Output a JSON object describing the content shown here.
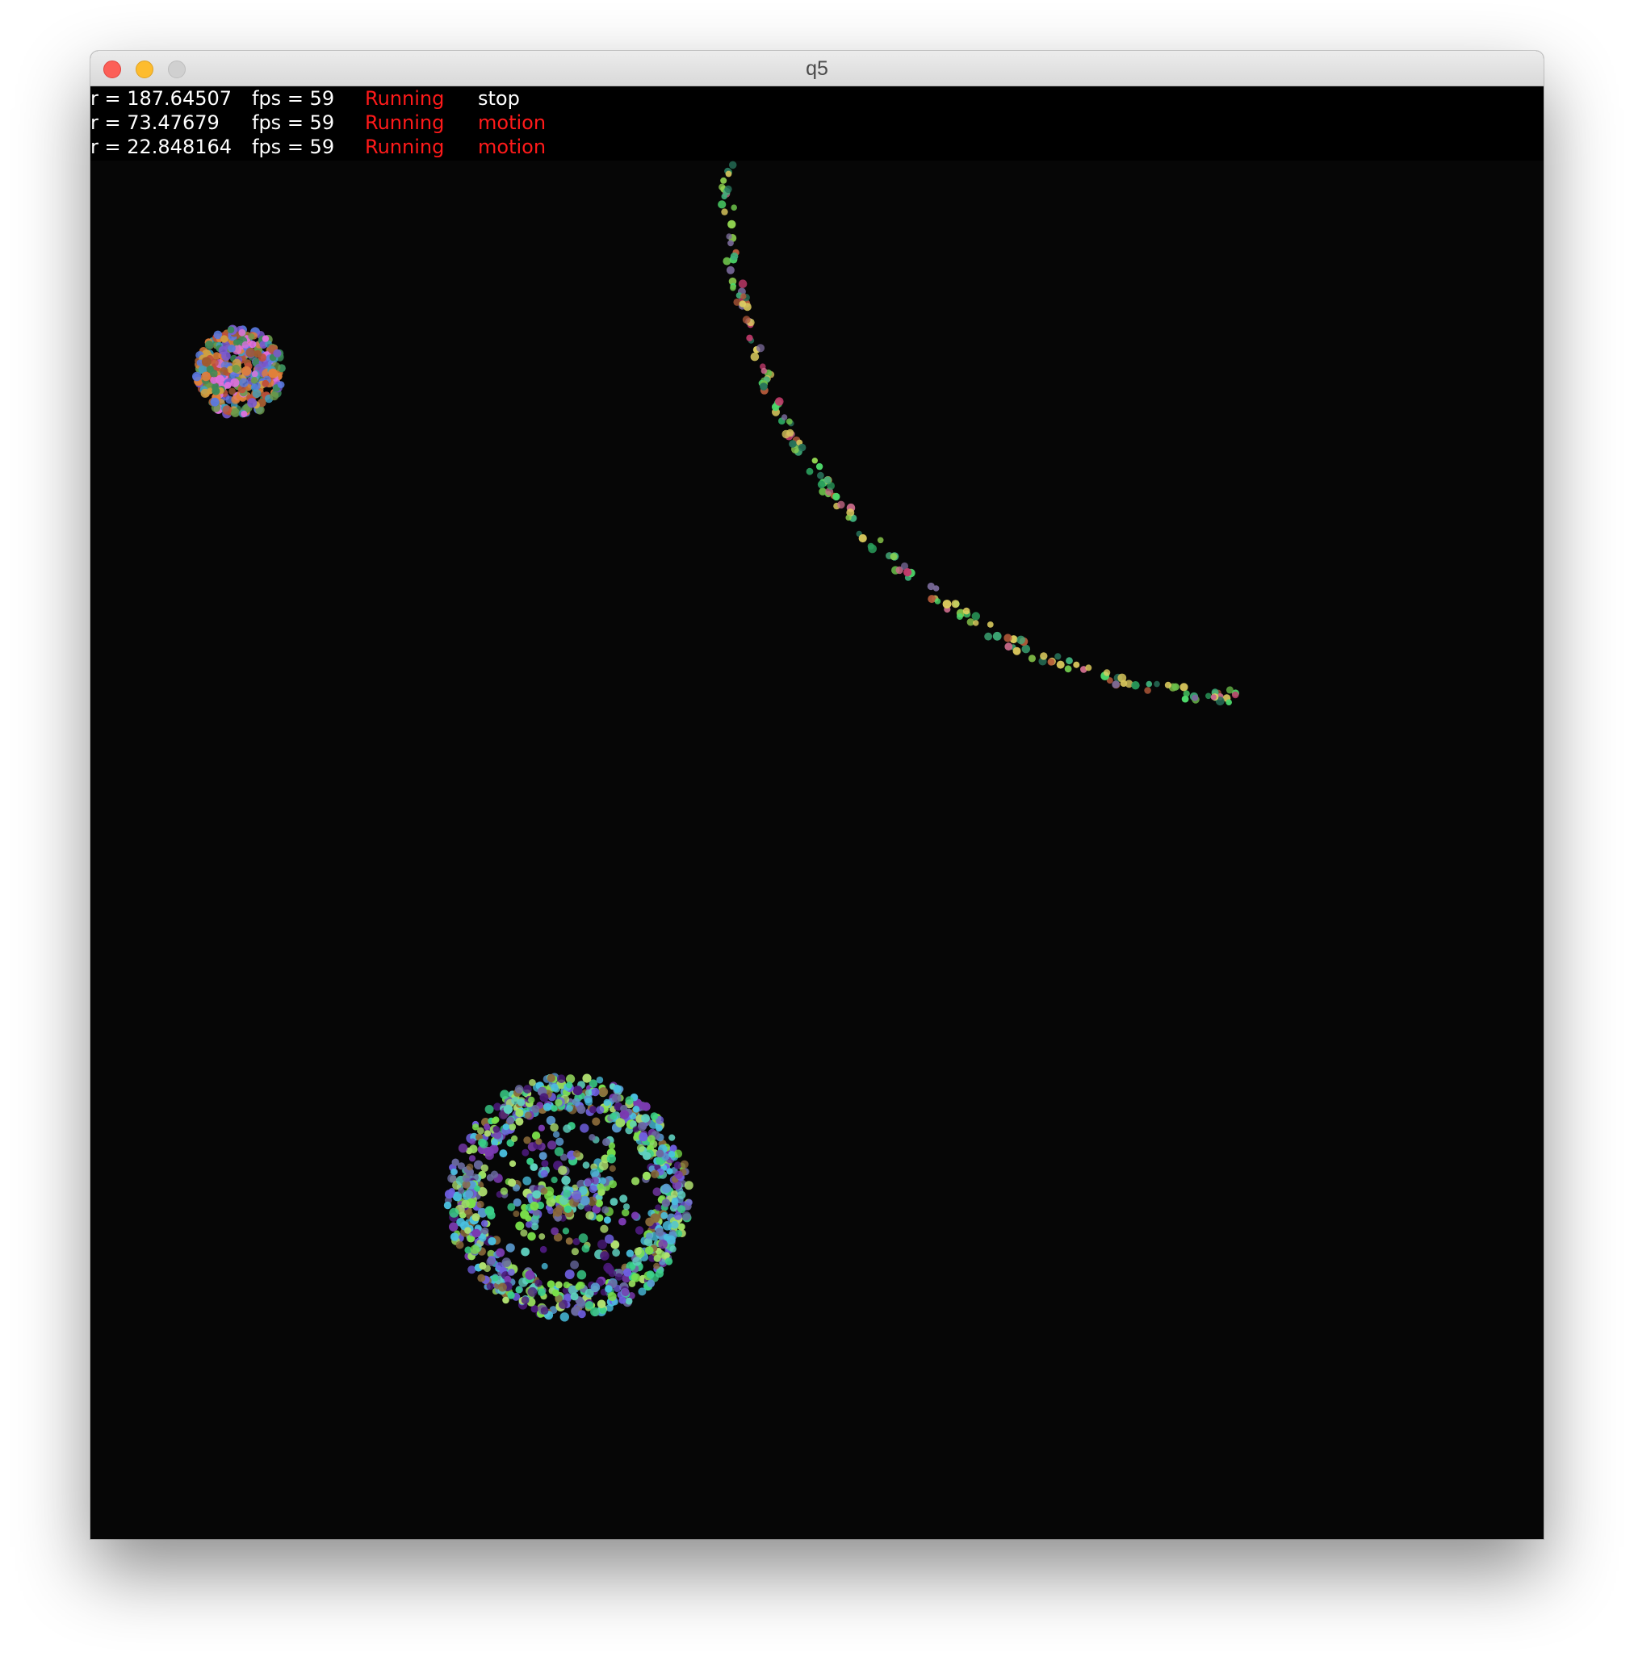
{
  "window": {
    "title": "q5"
  },
  "hud": {
    "rows": [
      {
        "r": "r = 187.64507",
        "fps": "fps = 59",
        "status": "Running",
        "mode": "stop",
        "status_color": "#ff1a1a",
        "mode_color": "#ffffff"
      },
      {
        "r": "r = 73.47679",
        "fps": "fps = 59",
        "status": "Running",
        "mode": "motion",
        "status_color": "#ff1a1a",
        "mode_color": "#ff1a1a"
      },
      {
        "r": "r = 22.848164",
        "fps": "fps = 59",
        "status": "Running",
        "mode": "motion",
        "status_color": "#ff1a1a",
        "mode_color": "#ff1a1a"
      }
    ]
  },
  "colors": {
    "canvas_background": "#060606",
    "hud_background": "#000000",
    "text_default": "#ffffff",
    "text_running": "#ff1a1a"
  },
  "particle_clusters": [
    {
      "name": "large-ring-cluster",
      "radius_value": 187.64507,
      "palette": [
        "#2a9d5c",
        "#c23a6b",
        "#8fd14f",
        "#3fae7a",
        "#d4c25a",
        "#6bbf4a",
        "#c96a8a",
        "#4dd86a",
        "#b45a3a",
        "#27725a",
        "#e0d060",
        "#7a6a9a"
      ]
    },
    {
      "name": "medium-disc-cluster",
      "radius_value": 73.47679,
      "palette": [
        "#6f5fe0",
        "#7ae04a",
        "#5fd0c0",
        "#8a6a3a",
        "#4a1a7a",
        "#9ae060",
        "#5a9ad0",
        "#7a3ab0",
        "#3ad08a",
        "#6a6aa0",
        "#b0e070",
        "#4ac0e0"
      ]
    },
    {
      "name": "small-disc-cluster",
      "radius_value": 22.848164,
      "palette": [
        "#e070e0",
        "#5a7ae0",
        "#e0803a",
        "#3a8a5a",
        "#c0503a",
        "#7a5ad0",
        "#d0a040",
        "#40a0c0",
        "#a05a30",
        "#6a9a4a"
      ]
    }
  ]
}
